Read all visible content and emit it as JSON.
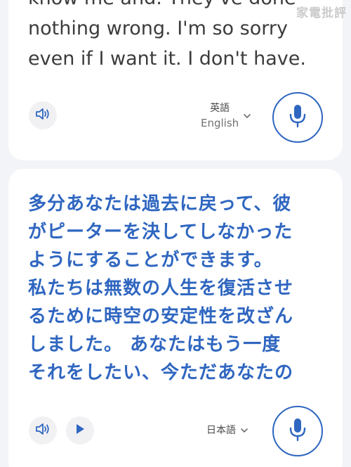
{
  "watermark": "家電批評",
  "source_card": {
    "text": "know me and. They've done\nnothing wrong. I'm so sorry\neven if I want it. I don't have.",
    "language_native": "英語",
    "language_english": "English",
    "icons": {
      "speaker": "speaker-icon",
      "mic": "microphone-icon",
      "chevron": "chevron-down-icon"
    }
  },
  "target_card": {
    "text": "多分あなたは過去に戻って、彼\nがピーターを決してしなかった\nようにすることができます。\n私たちは無数の人生を復活させ\nるために時空の安定性を改ざん\nしました。 あなたはもう一度\nそれをしたい、今ただあなたの",
    "language": "日本語",
    "icons": {
      "speaker": "speaker-icon",
      "play": "play-icon",
      "mic": "microphone-icon",
      "chevron": "chevron-down-icon"
    }
  },
  "colors": {
    "accent": "#2f66c0",
    "background": "#f3f4f7",
    "card": "#ffffff",
    "source_text": "#3c3c3c"
  }
}
